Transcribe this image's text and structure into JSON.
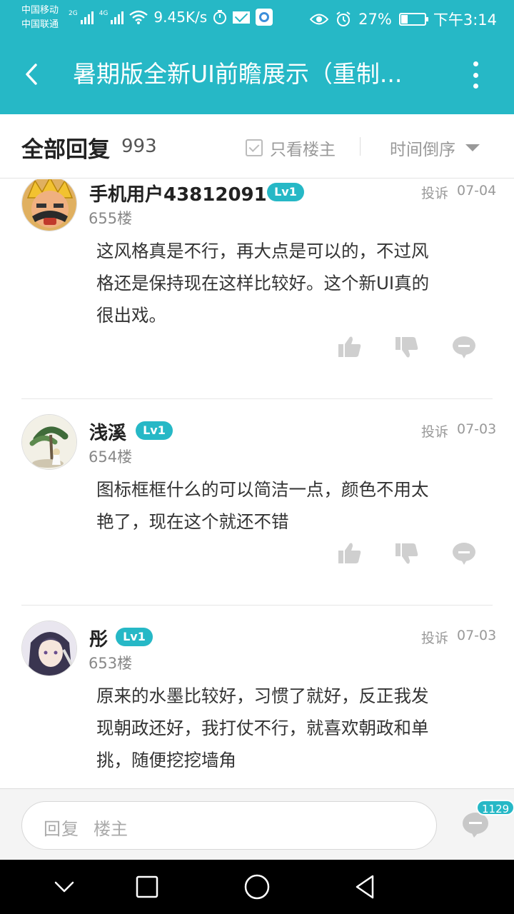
{
  "status_bar": {
    "carrier1": "中国移动",
    "carrier2": "中国联通",
    "net1": "2G",
    "net2": "4G",
    "speed": "9.45K/s",
    "battery": "27%",
    "battery_level": 0.27,
    "time": "下午3:14"
  },
  "app_bar": {
    "title": "暑期版全新UI前瞻展示（重制...",
    "back_icon": "back-arrow-icon",
    "more_icon": "more-vert-icon"
  },
  "sub_header": {
    "title": "全部回复",
    "count": "993",
    "only_op_label": "只看楼主",
    "sort_label": "时间倒序"
  },
  "comments": [
    {
      "user": "手机用户43812091",
      "level": "Lv1",
      "floor": "655楼",
      "report": "投诉",
      "date": "07-04",
      "lines": [
        "这风格真是不行，再大点是可以的，不过风",
        "格还是保持现在这样比较好。这个新UI真的",
        "很出戏。"
      ]
    },
    {
      "user": "浅溪",
      "level": "Lv1",
      "floor": "654楼",
      "report": "投诉",
      "date": "07-03",
      "lines": [
        "图标框框什么的可以简洁一点，颜色不用太",
        "艳了，现在这个就还不错"
      ]
    },
    {
      "user": "彤",
      "level": "Lv1",
      "floor": "653楼",
      "report": "投诉",
      "date": "07-03",
      "lines": [
        "原来的水墨比较好，习惯了就好，反正我发",
        "现朝政还好，我打仗不行，就喜欢朝政和单",
        "挑，随便挖挖墙角"
      ]
    }
  ],
  "reply_bar": {
    "placeholder_prefix": "回复",
    "placeholder_target": "楼主",
    "badge": "1129"
  },
  "colors": {
    "accent": "#26b8c6",
    "icon_gray": "#cfcfcf"
  }
}
